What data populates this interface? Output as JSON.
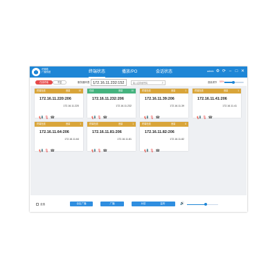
{
  "app": {
    "name_line1": "IP网络",
    "name_line2": "广播系统"
  },
  "tabs": [
    {
      "label": "终端状态"
    },
    {
      "label": "播放/PO"
    },
    {
      "label": "会话状态"
    }
  ],
  "user": {
    "name": "admin"
  },
  "window_icons": {
    "gear": "⚙",
    "refresh": "⟳",
    "minimize": "–",
    "maximize": "□",
    "close": "✕"
  },
  "toolbar": {
    "online_label": "在线终端",
    "offline_label": "不显",
    "list_label": "服务器列表",
    "server_value": "172.16.11.232:152",
    "search_placeholder": "输入名称或号码",
    "volume_label": "音量调节",
    "volume_value": "50%",
    "volume_level": 0.45
  },
  "colors": {
    "accent": "#1e86d6",
    "card_header": "#d9a53a",
    "card_header_alt": "#45b37e",
    "online": "#e64a4a"
  },
  "terminals": [
    {
      "status": "终端在线",
      "vol": "音量",
      "num": "10",
      "ip": "172.16.11.220:206",
      "addr": "172.16.11.220",
      "alt": false
    },
    {
      "status": "在线",
      "vol": "音量",
      "num": "10",
      "ip": "172.16.11.232:206",
      "addr": "172.16.11.232",
      "alt": true
    },
    {
      "status": "终端在线",
      "vol": "音量",
      "num": "1",
      "ip": "172.16.11.39:206",
      "addr": "172.16.11.39",
      "alt": false
    },
    {
      "status": "终端在线",
      "vol": "音量",
      "num": "1",
      "ip": "172.16.11.41:206",
      "addr": "172.16.11.41",
      "alt": false
    },
    {
      "status": "终端在线",
      "vol": "音量",
      "num": "1",
      "ip": "172.16.11.64:206",
      "addr": "172.16.11.64",
      "alt": false
    },
    {
      "status": "终端在线",
      "vol": "音量",
      "num": "1",
      "ip": "172.16.11.81:206",
      "addr": "172.16.11.81",
      "alt": false
    },
    {
      "status": "终端在线",
      "vol": "音量",
      "num": "6",
      "ip": "172.16.11.82:206",
      "addr": "172.16.11.82",
      "alt": false
    }
  ],
  "card_icons": {
    "broadcast": "📢",
    "mic": "🎙",
    "call": "☎"
  },
  "bottom": {
    "select_all": "全选",
    "buttons": [
      "全区广播",
      "广播",
      "对讲",
      "监听"
    ],
    "speaker_icon": "🔊",
    "master_volume": 0.6
  }
}
